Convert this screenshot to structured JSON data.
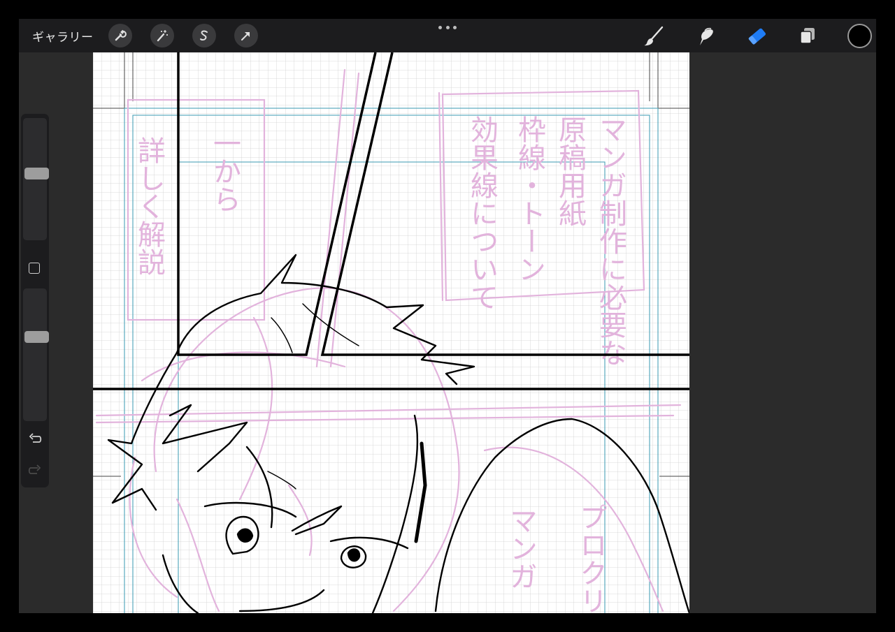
{
  "topbar": {
    "gallery_label": "ギャラリー",
    "left_tools": [
      {
        "name": "actions-tool",
        "icon": "wrench-icon"
      },
      {
        "name": "adjustments-tool",
        "icon": "magic-wand-icon"
      },
      {
        "name": "selection-tool",
        "icon": "selection-s-icon"
      },
      {
        "name": "transform-tool",
        "icon": "arrow-cursor-icon"
      }
    ],
    "more_menu_icon": "ellipsis-icon",
    "right_tools": [
      {
        "name": "brush-tool",
        "icon": "brush-icon",
        "active": false
      },
      {
        "name": "smudge-tool",
        "icon": "smudge-finger-icon",
        "active": false
      },
      {
        "name": "eraser-tool",
        "icon": "eraser-icon",
        "active": true
      },
      {
        "name": "layers-tool",
        "icon": "layers-icon",
        "active": false
      }
    ],
    "current_color": "#000000",
    "active_color": "#1f7cf5"
  },
  "sidebar": {
    "brush_size_level": 0.55,
    "opacity_level": 0.65,
    "modify_button_icon": "square-icon",
    "undo_icon": "undo-icon",
    "redo_icon": "redo-icon",
    "redo_enabled": false
  },
  "canvas": {
    "sketch_color": "#e2b3dc",
    "guide_color": "#4aa3b8",
    "ink_color": "#000000",
    "sketch_text_left_columns": [
      "詳しく解説",
      "一から"
    ],
    "sketch_text_right_columns": [
      "マンガ制作に必要な",
      "原稿用紙",
      "枠線・トーン",
      "効果線について"
    ],
    "sketch_text_bottom_columns": [
      "プロクリ",
      "マンガ"
    ]
  }
}
